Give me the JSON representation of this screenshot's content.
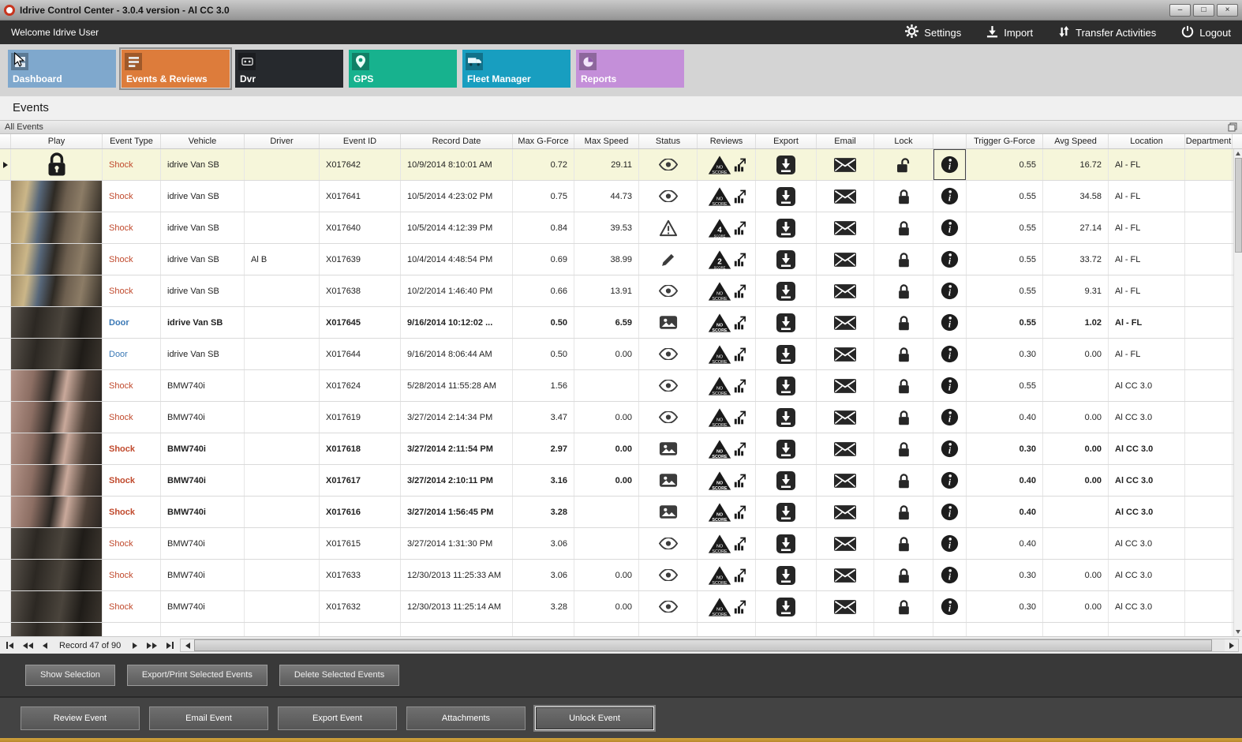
{
  "window": {
    "title": "Idrive Control Center - 3.0.4 version - Al CC 3.0",
    "minimize": "–",
    "maximize": "□",
    "close": "×"
  },
  "topbar": {
    "welcome": "Welcome Idrive User",
    "actions": [
      {
        "id": "settings",
        "label": "Settings",
        "icon": "gear-icon"
      },
      {
        "id": "import",
        "label": "Import",
        "icon": "import-icon"
      },
      {
        "id": "transfer-activities",
        "label": "Transfer Activities",
        "icon": "transfer-icon"
      },
      {
        "id": "logout",
        "label": "Logout",
        "icon": "power-icon"
      }
    ]
  },
  "nav": {
    "tiles": [
      {
        "id": "dashboard",
        "label": "Dashboard",
        "color": "#7fa8cd",
        "selected": false
      },
      {
        "id": "events",
        "label": "Events & Reviews",
        "color": "#dd7c3b",
        "selected": true
      },
      {
        "id": "dvr",
        "label": "Dvr",
        "color": "#26292d",
        "selected": false
      },
      {
        "id": "gps",
        "label": "GPS",
        "color": "#17b28e",
        "selected": false
      },
      {
        "id": "fleet",
        "label": "Fleet Manager",
        "color": "#189ec0",
        "selected": false
      },
      {
        "id": "reports",
        "label": "Reports",
        "color": "#c48fd9",
        "selected": false
      }
    ]
  },
  "page": {
    "title": "Events"
  },
  "panel": {
    "title": "All Events"
  },
  "table": {
    "columns": [
      "",
      "Play",
      "Event Type",
      "Vehicle",
      "Driver",
      "Event ID",
      "Record Date",
      "Max G-Force",
      "Max Speed",
      "Status",
      "Reviews",
      "Export",
      "Email",
      "Lock",
      "",
      "Trigger G-Force",
      "Avg Speed",
      "Location",
      "Department"
    ],
    "rows": [
      {
        "play": "lock",
        "type": "Shock",
        "vehicle": "idrive Van SB",
        "driver": "",
        "event_id": "X017642",
        "record_date": "10/9/2014 8:10:01 AM",
        "max_g": "0.72",
        "max_speed": "29.11",
        "status": "eye",
        "review": "NO SCORE",
        "lock": "unlocked",
        "trigger_g": "0.55",
        "avg_speed": "16.72",
        "location": "Al - FL",
        "bold": false,
        "selected": true
      },
      {
        "play": "photo",
        "type": "Shock",
        "vehicle": "idrive Van SB",
        "driver": "",
        "event_id": "X017641",
        "record_date": "10/5/2014 4:23:02 PM",
        "max_g": "0.75",
        "max_speed": "44.73",
        "status": "eye",
        "review": "NO SCORE",
        "lock": "locked",
        "trigger_g": "0.55",
        "avg_speed": "34.58",
        "location": "Al - FL",
        "bold": false,
        "selected": false
      },
      {
        "play": "photo",
        "type": "Shock",
        "vehicle": "idrive Van SB",
        "driver": "",
        "event_id": "X017640",
        "record_date": "10/5/2014 4:12:39 PM",
        "max_g": "0.84",
        "max_speed": "39.53",
        "status": "warning",
        "review": "4",
        "lock": "locked",
        "trigger_g": "0.55",
        "avg_speed": "27.14",
        "location": "Al - FL",
        "bold": false,
        "selected": false
      },
      {
        "play": "photo",
        "type": "Shock",
        "vehicle": "idrive Van SB",
        "driver": "Al B",
        "event_id": "X017639",
        "record_date": "10/4/2014 4:48:54 PM",
        "max_g": "0.69",
        "max_speed": "38.99",
        "status": "pencil",
        "review": "2",
        "lock": "locked",
        "trigger_g": "0.55",
        "avg_speed": "33.72",
        "location": "Al - FL",
        "bold": false,
        "selected": false
      },
      {
        "play": "photo",
        "type": "Shock",
        "vehicle": "idrive Van SB",
        "driver": "",
        "event_id": "X017638",
        "record_date": "10/2/2014 1:46:40 PM",
        "max_g": "0.66",
        "max_speed": "13.91",
        "status": "eye",
        "review": "NO SCORE",
        "lock": "locked",
        "trigger_g": "0.55",
        "avg_speed": "9.31",
        "location": "Al - FL",
        "bold": false,
        "selected": false
      },
      {
        "play": "photo",
        "type": "Door",
        "vehicle": "idrive Van SB",
        "driver": "",
        "event_id": "X017645",
        "record_date": "9/16/2014 10:12:02 ...",
        "max_g": "0.50",
        "max_speed": "6.59",
        "status": "picture",
        "review": "NO SCORE",
        "lock": "locked",
        "trigger_g": "0.55",
        "avg_speed": "1.02",
        "location": "Al - FL",
        "bold": true,
        "selected": false
      },
      {
        "play": "photo",
        "type": "Door",
        "vehicle": "idrive Van SB",
        "driver": "",
        "event_id": "X017644",
        "record_date": "9/16/2014 8:06:44 AM",
        "max_g": "0.50",
        "max_speed": "0.00",
        "status": "eye",
        "review": "NO SCORE",
        "lock": "locked",
        "trigger_g": "0.30",
        "avg_speed": "0.00",
        "location": "Al - FL",
        "bold": false,
        "selected": false
      },
      {
        "play": "photo",
        "type": "Shock",
        "vehicle": "BMW740i",
        "driver": "",
        "event_id": "X017624",
        "record_date": "5/28/2014 11:55:28 AM",
        "max_g": "1.56",
        "max_speed": "",
        "status": "eye",
        "review": "NO SCORE",
        "lock": "locked",
        "trigger_g": "0.55",
        "avg_speed": "",
        "location": "Al CC 3.0",
        "bold": false,
        "selected": false
      },
      {
        "play": "photo",
        "type": "Shock",
        "vehicle": "BMW740i",
        "driver": "",
        "event_id": "X017619",
        "record_date": "3/27/2014 2:14:34 PM",
        "max_g": "3.47",
        "max_speed": "0.00",
        "status": "eye",
        "review": "NO SCORE",
        "lock": "locked",
        "trigger_g": "0.40",
        "avg_speed": "0.00",
        "location": "Al CC 3.0",
        "bold": false,
        "selected": false
      },
      {
        "play": "photo",
        "type": "Shock",
        "vehicle": "BMW740i",
        "driver": "",
        "event_id": "X017618",
        "record_date": "3/27/2014 2:11:54 PM",
        "max_g": "2.97",
        "max_speed": "0.00",
        "status": "picture",
        "review": "NO SCORE",
        "lock": "locked",
        "trigger_g": "0.30",
        "avg_speed": "0.00",
        "location": "Al CC 3.0",
        "bold": true,
        "selected": false
      },
      {
        "play": "photo",
        "type": "Shock",
        "vehicle": "BMW740i",
        "driver": "",
        "event_id": "X017617",
        "record_date": "3/27/2014 2:10:11 PM",
        "max_g": "3.16",
        "max_speed": "0.00",
        "status": "picture",
        "review": "NO SCORE",
        "lock": "locked",
        "trigger_g": "0.40",
        "avg_speed": "0.00",
        "location": "Al CC 3.0",
        "bold": true,
        "selected": false
      },
      {
        "play": "photo",
        "type": "Shock",
        "vehicle": "BMW740i",
        "driver": "",
        "event_id": "X017616",
        "record_date": "3/27/2014 1:56:45 PM",
        "max_g": "3.28",
        "max_speed": "",
        "status": "picture",
        "review": "NO SCORE",
        "lock": "locked",
        "trigger_g": "0.40",
        "avg_speed": "",
        "location": "Al CC 3.0",
        "bold": true,
        "selected": false
      },
      {
        "play": "photo",
        "type": "Shock",
        "vehicle": "BMW740i",
        "driver": "",
        "event_id": "X017615",
        "record_date": "3/27/2014 1:31:30 PM",
        "max_g": "3.06",
        "max_speed": "",
        "status": "eye",
        "review": "NO SCORE",
        "lock": "locked",
        "trigger_g": "0.40",
        "avg_speed": "",
        "location": "Al CC 3.0",
        "bold": false,
        "selected": false
      },
      {
        "play": "photo",
        "type": "Shock",
        "vehicle": "BMW740i",
        "driver": "",
        "event_id": "X017633",
        "record_date": "12/30/2013 11:25:33 AM",
        "max_g": "3.06",
        "max_speed": "0.00",
        "status": "eye",
        "review": "NO SCORE",
        "lock": "locked",
        "trigger_g": "0.30",
        "avg_speed": "0.00",
        "location": "Al CC 3.0",
        "bold": false,
        "selected": false
      },
      {
        "play": "photo",
        "type": "Shock",
        "vehicle": "BMW740i",
        "driver": "",
        "event_id": "X017632",
        "record_date": "12/30/2013 11:25:14 AM",
        "max_g": "3.28",
        "max_speed": "0.00",
        "status": "eye",
        "review": "NO SCORE",
        "lock": "locked",
        "trigger_g": "0.30",
        "avg_speed": "0.00",
        "location": "Al CC 3.0",
        "bold": false,
        "selected": false
      },
      {
        "partial": true,
        "play": "photo",
        "type": "",
        "vehicle": "",
        "driver": "",
        "event_id": "",
        "record_date": "",
        "max_g": "",
        "max_speed": "",
        "status": "",
        "review": "",
        "lock": "",
        "trigger_g": "",
        "avg_speed": "",
        "location": "",
        "bold": false,
        "selected": false
      }
    ]
  },
  "pager": {
    "record_text": "Record 47 of 90"
  },
  "selection_bar": {
    "buttons": [
      {
        "id": "show-selection",
        "label": "Show Selection"
      },
      {
        "id": "export-print-selected-events",
        "label": "Export/Print Selected Events"
      },
      {
        "id": "delete-selected-events",
        "label": "Delete Selected  Events"
      }
    ]
  },
  "action_bar": {
    "buttons": [
      {
        "id": "review-event",
        "label": "Review Event"
      },
      {
        "id": "email-event",
        "label": "Email Event"
      },
      {
        "id": "export-event",
        "label": "Export Event"
      },
      {
        "id": "attachments",
        "label": "Attachments"
      },
      {
        "id": "unlock-event",
        "label": "Unlock Event",
        "focused": true
      }
    ]
  },
  "colors": {
    "shock_text": "#c0492c",
    "door_text": "#3a78b5",
    "selected_row": "#f6f6da",
    "accent_orange": "#dd7c3b"
  }
}
